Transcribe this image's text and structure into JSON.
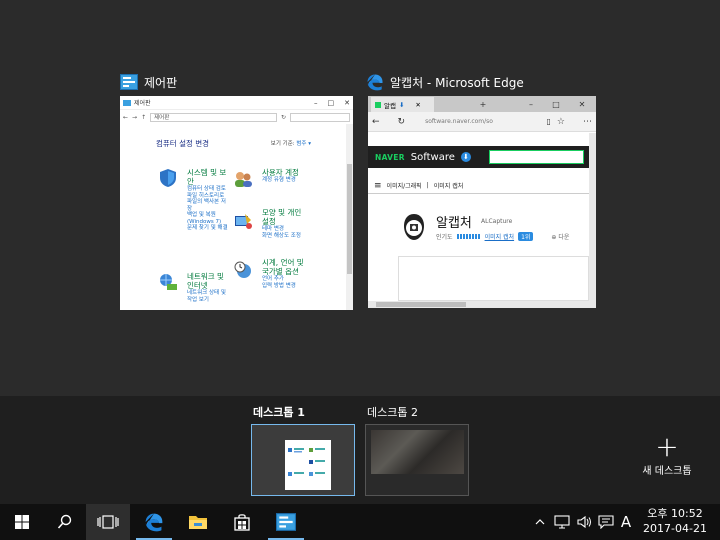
{
  "windows": [
    {
      "title": "제어판",
      "icon": "control-panel-icon"
    },
    {
      "title": "알캡처 - Microsoft Edge",
      "icon": "edge-icon"
    }
  ],
  "control_panel": {
    "window_title": "제어판",
    "address": "제어판",
    "heading": "컴퓨터 설정 변경",
    "view_by_label": "보기 기준:",
    "view_by_value": "범주 ▾",
    "categories": [
      {
        "title": "시스템 및 보안",
        "links": [
          "컴퓨터 상태 검토",
          "파일 히스토리로 파일의 백사본 저장",
          "백업 및 복원(Windows 7)",
          "문제 찾기 및 해결"
        ]
      },
      {
        "title": "사용자 계정",
        "links": [
          "계정 유형 변경"
        ]
      },
      {
        "title": "네트워크 및 인터넷",
        "links": [
          "네트워크 상태 및 작업 보기"
        ]
      },
      {
        "title": "모양 및 개인 설정",
        "links": [
          "테마 변경",
          "화면 해상도 조정"
        ]
      },
      {
        "title": "시계, 언어 및 국가별 옵션",
        "links": [
          "언어 추가",
          "입력 방법 변경"
        ]
      }
    ]
  },
  "edge": {
    "tab_label": "알캡",
    "url": "software.naver.com/so",
    "naver_logo": "NAVER",
    "software_logo": "Software",
    "menu_items": [
      "이미지/그래픽",
      "이미지 캡처"
    ],
    "app_name": "알캡처",
    "app_sub": "ALCapture",
    "popularity_label": "인기도",
    "popularity_link": "이미지 캡처",
    "rank": "1위",
    "download": "다운"
  },
  "desktops": [
    {
      "label": "데스크톱 1",
      "active": true
    },
    {
      "label": "데스크톱 2",
      "active": false
    }
  ],
  "new_desktop_label": "새 데스크톱",
  "taskbar": {
    "ampm_time": "오후 10:52",
    "date": "2017-04-21",
    "ime": "A"
  }
}
